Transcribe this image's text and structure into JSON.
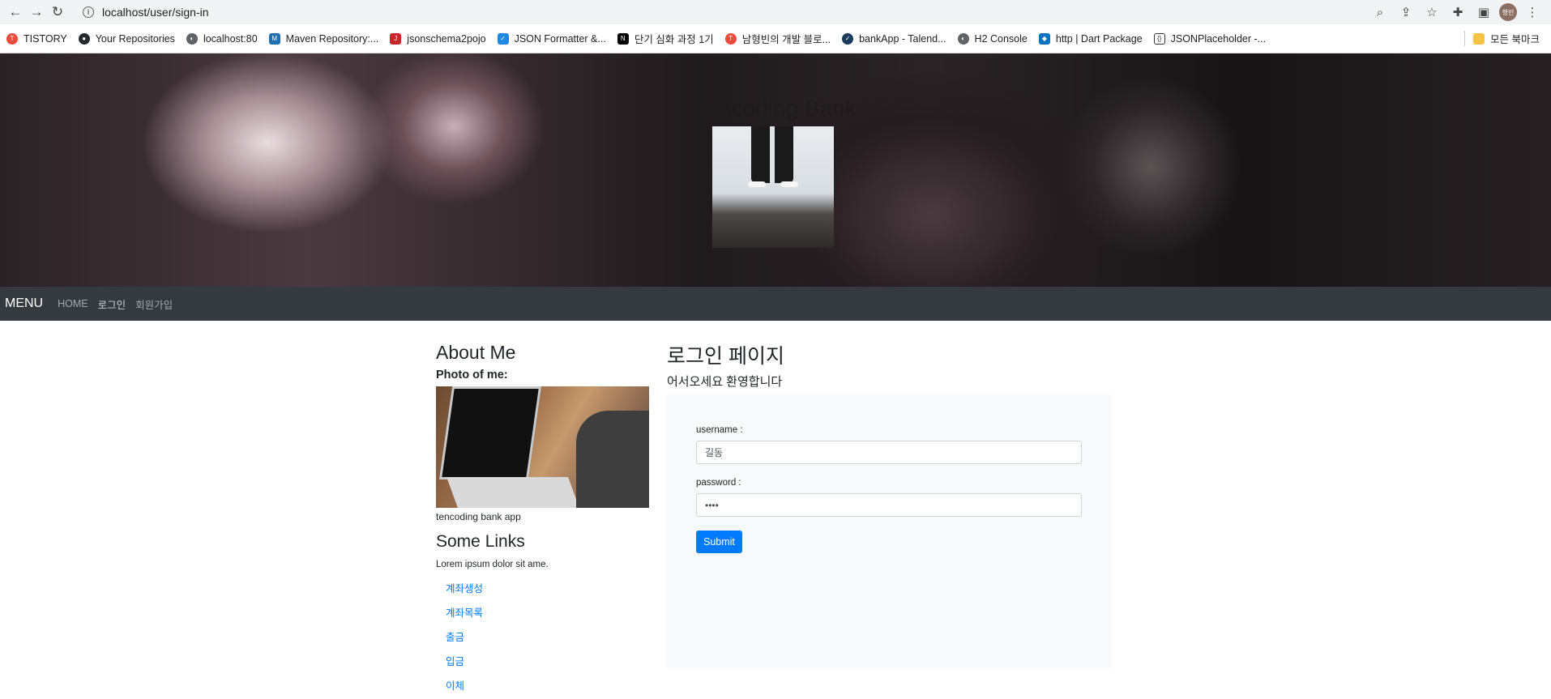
{
  "browser": {
    "url": "localhost/user/sign-in",
    "profile": "형빈"
  },
  "bookmarks": [
    {
      "label": "TISTORY",
      "color": "#e84c3d",
      "icon": "T"
    },
    {
      "label": "Your Repositories",
      "color": "#24292e",
      "icon": "●"
    },
    {
      "label": "localhost:80",
      "color": "#5f6368",
      "icon": "◐"
    },
    {
      "label": "Maven Repository:...",
      "color": "#1f6fb2",
      "icon": "M"
    },
    {
      "label": "jsonschema2pojo",
      "color": "#c62828",
      "icon": "J"
    },
    {
      "label": "JSON Formatter &...",
      "color": "#1e88e5",
      "icon": "✓"
    },
    {
      "label": "단기 심화 과정 1기",
      "color": "#000000",
      "icon": "N"
    },
    {
      "label": "남형빈의 개발 블로...",
      "color": "#e84c3d",
      "icon": "T"
    },
    {
      "label": "bankApp - Talend...",
      "color": "#1a3b5d",
      "icon": "✓"
    },
    {
      "label": "H2 Console",
      "color": "#5f6368",
      "icon": "◐"
    },
    {
      "label": "http | Dart Package",
      "color": "#0175c2",
      "icon": "◆"
    },
    {
      "label": "JSONPlaceholder -...",
      "color": "#333333",
      "icon": "{}"
    }
  ],
  "bookmarks_all": "모든 북마크",
  "hero": {
    "title": "Tencoding Bank"
  },
  "navbar": {
    "brand": "MENU",
    "links": [
      "HOME",
      "로그인",
      "회원가입"
    ]
  },
  "sidebar": {
    "about_title": "About Me",
    "photo_label": "Photo of me:",
    "caption": "tencoding bank app",
    "links_title": "Some Links",
    "lorem": "Lorem ipsum dolor sit ame.",
    "links": [
      "계좌생성",
      "계좌목록",
      "출금",
      "입금",
      "이체"
    ]
  },
  "main": {
    "title": "로그인 페이지",
    "subtitle": "어서오세요 환영합니다",
    "username_label": "username :",
    "username_value": "길동",
    "password_label": "password :",
    "password_value": "••••",
    "submit_label": "Submit"
  }
}
